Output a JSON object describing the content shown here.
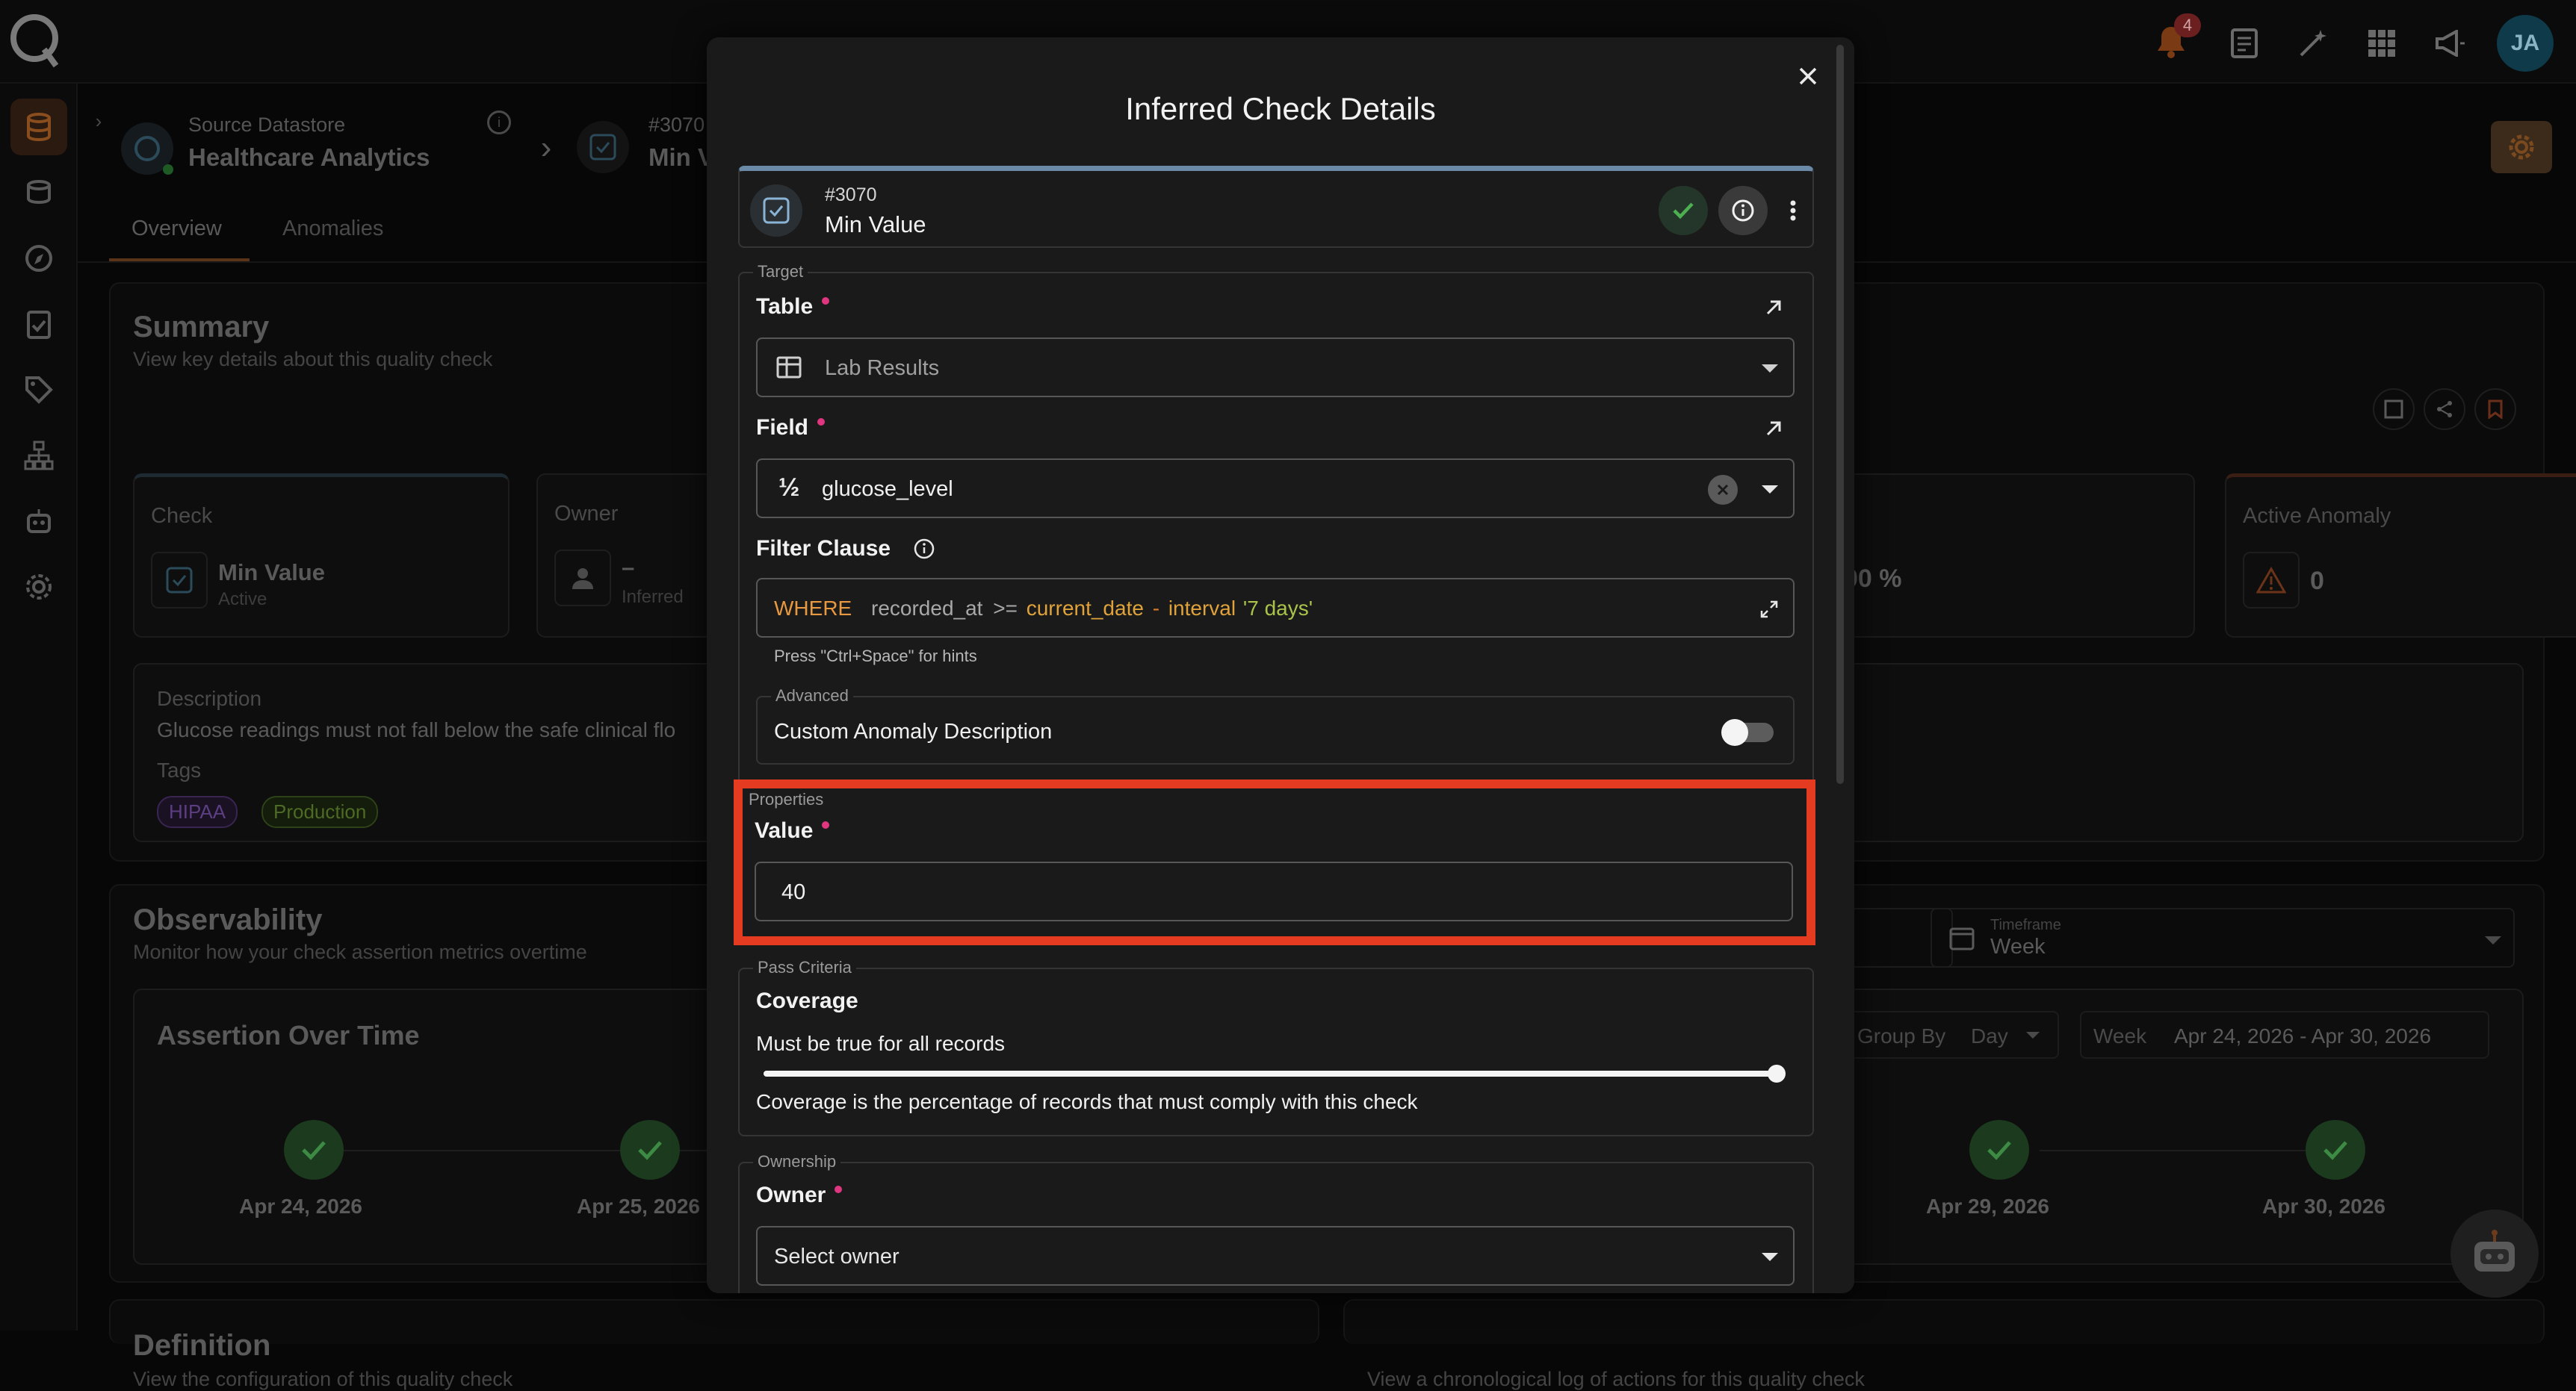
{
  "topbar": {
    "notif_count": "4",
    "avatar": "JA",
    "icons": [
      "logo-icon",
      "bell-icon",
      "document-icon",
      "magic-icon",
      "grid-icon",
      "megaphone-icon"
    ]
  },
  "rail": {
    "items": [
      "database-icon",
      "datastores-icon",
      "compass-icon",
      "checklist-icon",
      "tag-icon",
      "hierarchy-icon",
      "robot-icon",
      "gear-icon"
    ]
  },
  "header": {
    "source_label": "Source Datastore",
    "source_name": "Healthcare Analytics",
    "check_id": "#3070",
    "check_name": "Min Va"
  },
  "tabs": [
    "Overview",
    "Anomalies"
  ],
  "summary": {
    "title": "Summary",
    "subtitle": "View key details about this quality check",
    "check_label": "Check",
    "check_name": "Min Value",
    "check_status": "Active",
    "owner_label": "Owner",
    "owner_value": "–",
    "owner_sub": "Inferred",
    "pct_fragment": "00 %",
    "anomaly_label": "Active Anomaly",
    "anomaly_value": "0",
    "desc_label": "Description",
    "desc_text": "Glucose readings must not fall below the safe clinical flo",
    "tags_label": "Tags",
    "tags": [
      "HIPAA",
      "Production"
    ]
  },
  "observability": {
    "title": "Observability",
    "subtitle": "Monitor how your check assertion metrics overtime",
    "timeframe_label": "Timeframe",
    "timeframe_value": "Week",
    "assertion_title": "Assertion Over Time",
    "group_by_label": "Group By",
    "group_by_value": "Day",
    "range_prefix": "Week",
    "range_value": "Apr 24, 2026 - Apr 30, 2026",
    "dates_left": [
      "Apr 24, 2026",
      "Apr 25, 2026"
    ],
    "dates_right": [
      "Apr 29, 2026",
      "Apr 30, 2026"
    ]
  },
  "definition": {
    "title": "Definition",
    "subtitle": "View the configuration of this quality check"
  },
  "activity": {
    "subtitle": "View a chronological log of actions for this quality check"
  },
  "modal": {
    "title": "Inferred Check Details",
    "check_id": "#3070",
    "check_name": "Min Value",
    "target_legend": "Target",
    "table_label": "Table",
    "table_value": "Lab Results",
    "field_label": "Field",
    "field_value": "glucose_level",
    "field_type_glyph": "½",
    "filter_label": "Filter Clause",
    "filter_where": "WHERE",
    "filter_col": "recorded_at",
    "filter_op": ">=",
    "filter_fn": "current_date",
    "filter_minus": "-",
    "filter_kw": "interval",
    "filter_str": "'7 days'",
    "filter_hint": "Press \"Ctrl+Space\" for hints",
    "advanced_legend": "Advanced",
    "custom_desc_label": "Custom Anomaly Description",
    "properties_legend": "Properties",
    "value_label": "Value",
    "value_input": "40",
    "pass_legend": "Pass Criteria",
    "coverage_label": "Coverage",
    "coverage_desc": "Must be true for all records",
    "coverage_value": 1.0,
    "coverage_note": "Coverage is the percentage of records that must comply with this check",
    "ownership_legend": "Ownership",
    "owner_label": "Owner",
    "owner_placeholder": "Select owner"
  },
  "colors": {
    "accent_orange": "#d97a2b",
    "success_green": "#4caf50",
    "highlight_red": "#e53b21",
    "tag_hipaa": "#9b6bd6",
    "tag_production": "#7fae3b"
  }
}
